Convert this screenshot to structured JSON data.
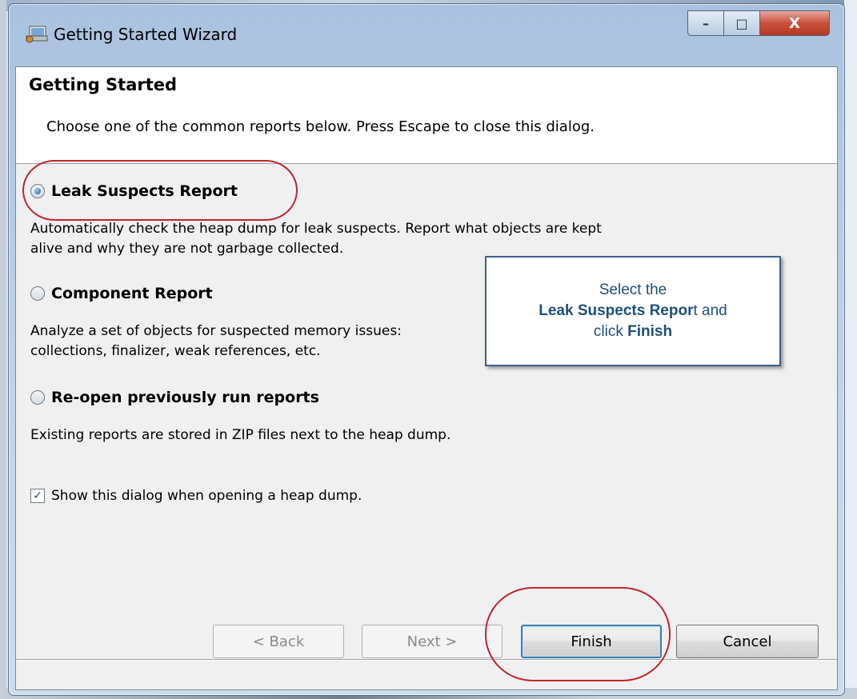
{
  "window": {
    "title": "Getting Started Wizard",
    "controls": {
      "minimize": "–",
      "maximize": "□",
      "close": "X"
    }
  },
  "header": {
    "title": "Getting Started",
    "description": "Choose one of the common reports below. Press Escape to close this dialog."
  },
  "options": [
    {
      "label": "Leak Suspects Report",
      "selected": true,
      "description_lines": [
        "Automatically check the heap dump for leak suspects. Report what objects are kept",
        "alive and why they are not garbage collected."
      ]
    },
    {
      "label": "Component Report",
      "selected": false,
      "description_lines": [
        "Analyze a set of objects for suspected memory issues:",
        "collections, finalizer, weak references, etc."
      ]
    },
    {
      "label": "Re-open previously run reports",
      "selected": false,
      "description_lines": [
        "Existing reports are stored in ZIP files next to the heap dump."
      ]
    }
  ],
  "show_dialog_checkbox": {
    "label": "Show this dialog when opening a heap dump.",
    "checked": true,
    "check_mark": "✓"
  },
  "buttons": {
    "back": "< Back",
    "next": "Next >",
    "finish": "Finish",
    "cancel": "Cancel"
  },
  "callout": {
    "line1": "Select the",
    "line2_bold": "Leak Suspects Repor",
    "line2_rest": "t and",
    "line3_prefix": "click ",
    "line3_bold": "Finish"
  },
  "colors": {
    "highlight_ring": "#c0262c",
    "callout_text": "#1f4e79",
    "default_button_border": "#3c7fb1"
  }
}
